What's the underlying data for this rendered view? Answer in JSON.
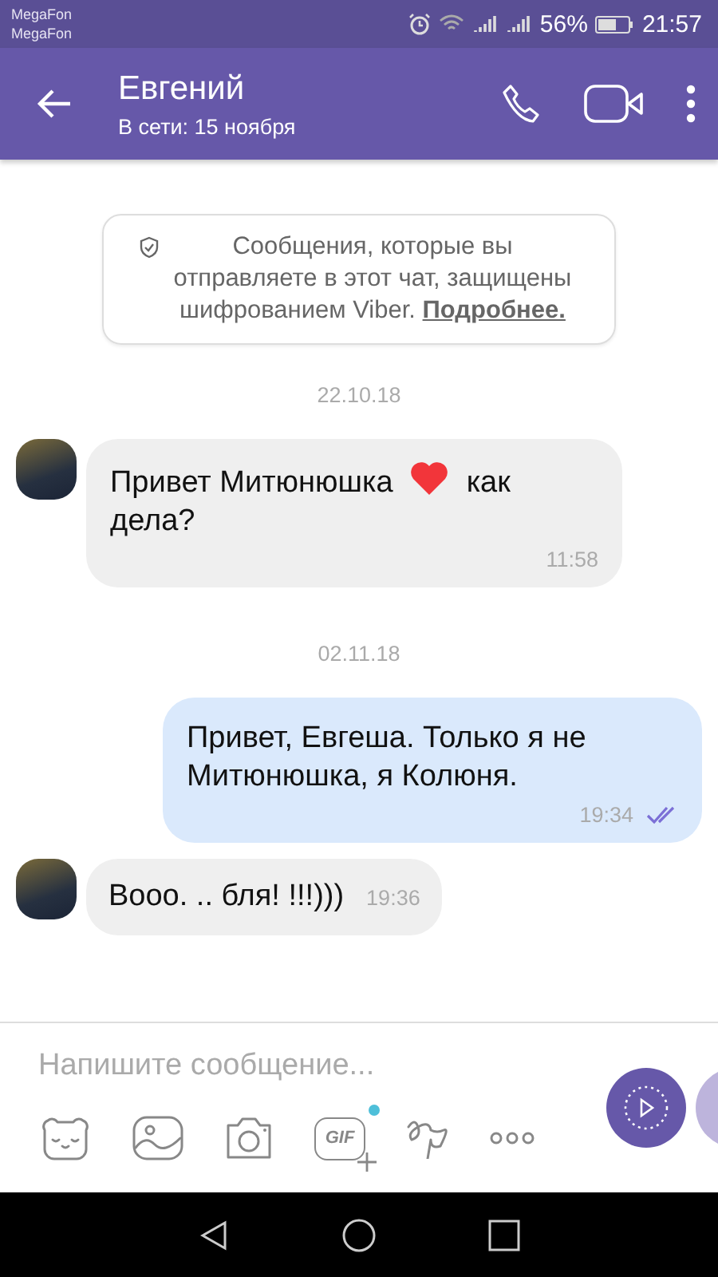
{
  "status_bar": {
    "carriers": [
      "MegaFon",
      "MegaFon"
    ],
    "battery": "56%",
    "time": "21:57"
  },
  "header": {
    "name": "Евгений",
    "subtitle": "В сети: 15 ноября"
  },
  "encryption_notice": {
    "text": "Сообщения, которые вы отправляете в этот чат, защищены шифрованием Viber.",
    "link": "Подробнее."
  },
  "messages": [
    {
      "kind": "date",
      "text": "22.10.18"
    },
    {
      "kind": "incoming",
      "parts": [
        {
          "kind": "text",
          "text": "Привет Митюнюшка"
        },
        {
          "kind": "heart"
        },
        {
          "kind": "text",
          "text": "как дела?"
        }
      ],
      "time": "11:58",
      "inline_time": false
    },
    {
      "kind": "date",
      "text": "02.11.18"
    },
    {
      "kind": "outgoing",
      "parts": [
        {
          "kind": "text",
          "text": "Привет, Евгеша. Только я не Митюнюшка, я Колюня."
        }
      ],
      "time": "19:34",
      "read": true,
      "inline_time": false
    },
    {
      "kind": "incoming",
      "parts": [
        {
          "kind": "text",
          "text": "Вооо. .. бля! !!!)))"
        }
      ],
      "time": "19:36",
      "inline_time": true
    }
  ],
  "composer": {
    "placeholder": "Напишите сообщение...",
    "tools": [
      {
        "kind": "sticker"
      },
      {
        "kind": "gallery"
      },
      {
        "kind": "camera"
      },
      {
        "kind": "gif",
        "label": "GIF",
        "badge": true
      },
      {
        "kind": "doodle"
      },
      {
        "kind": "more"
      }
    ]
  }
}
